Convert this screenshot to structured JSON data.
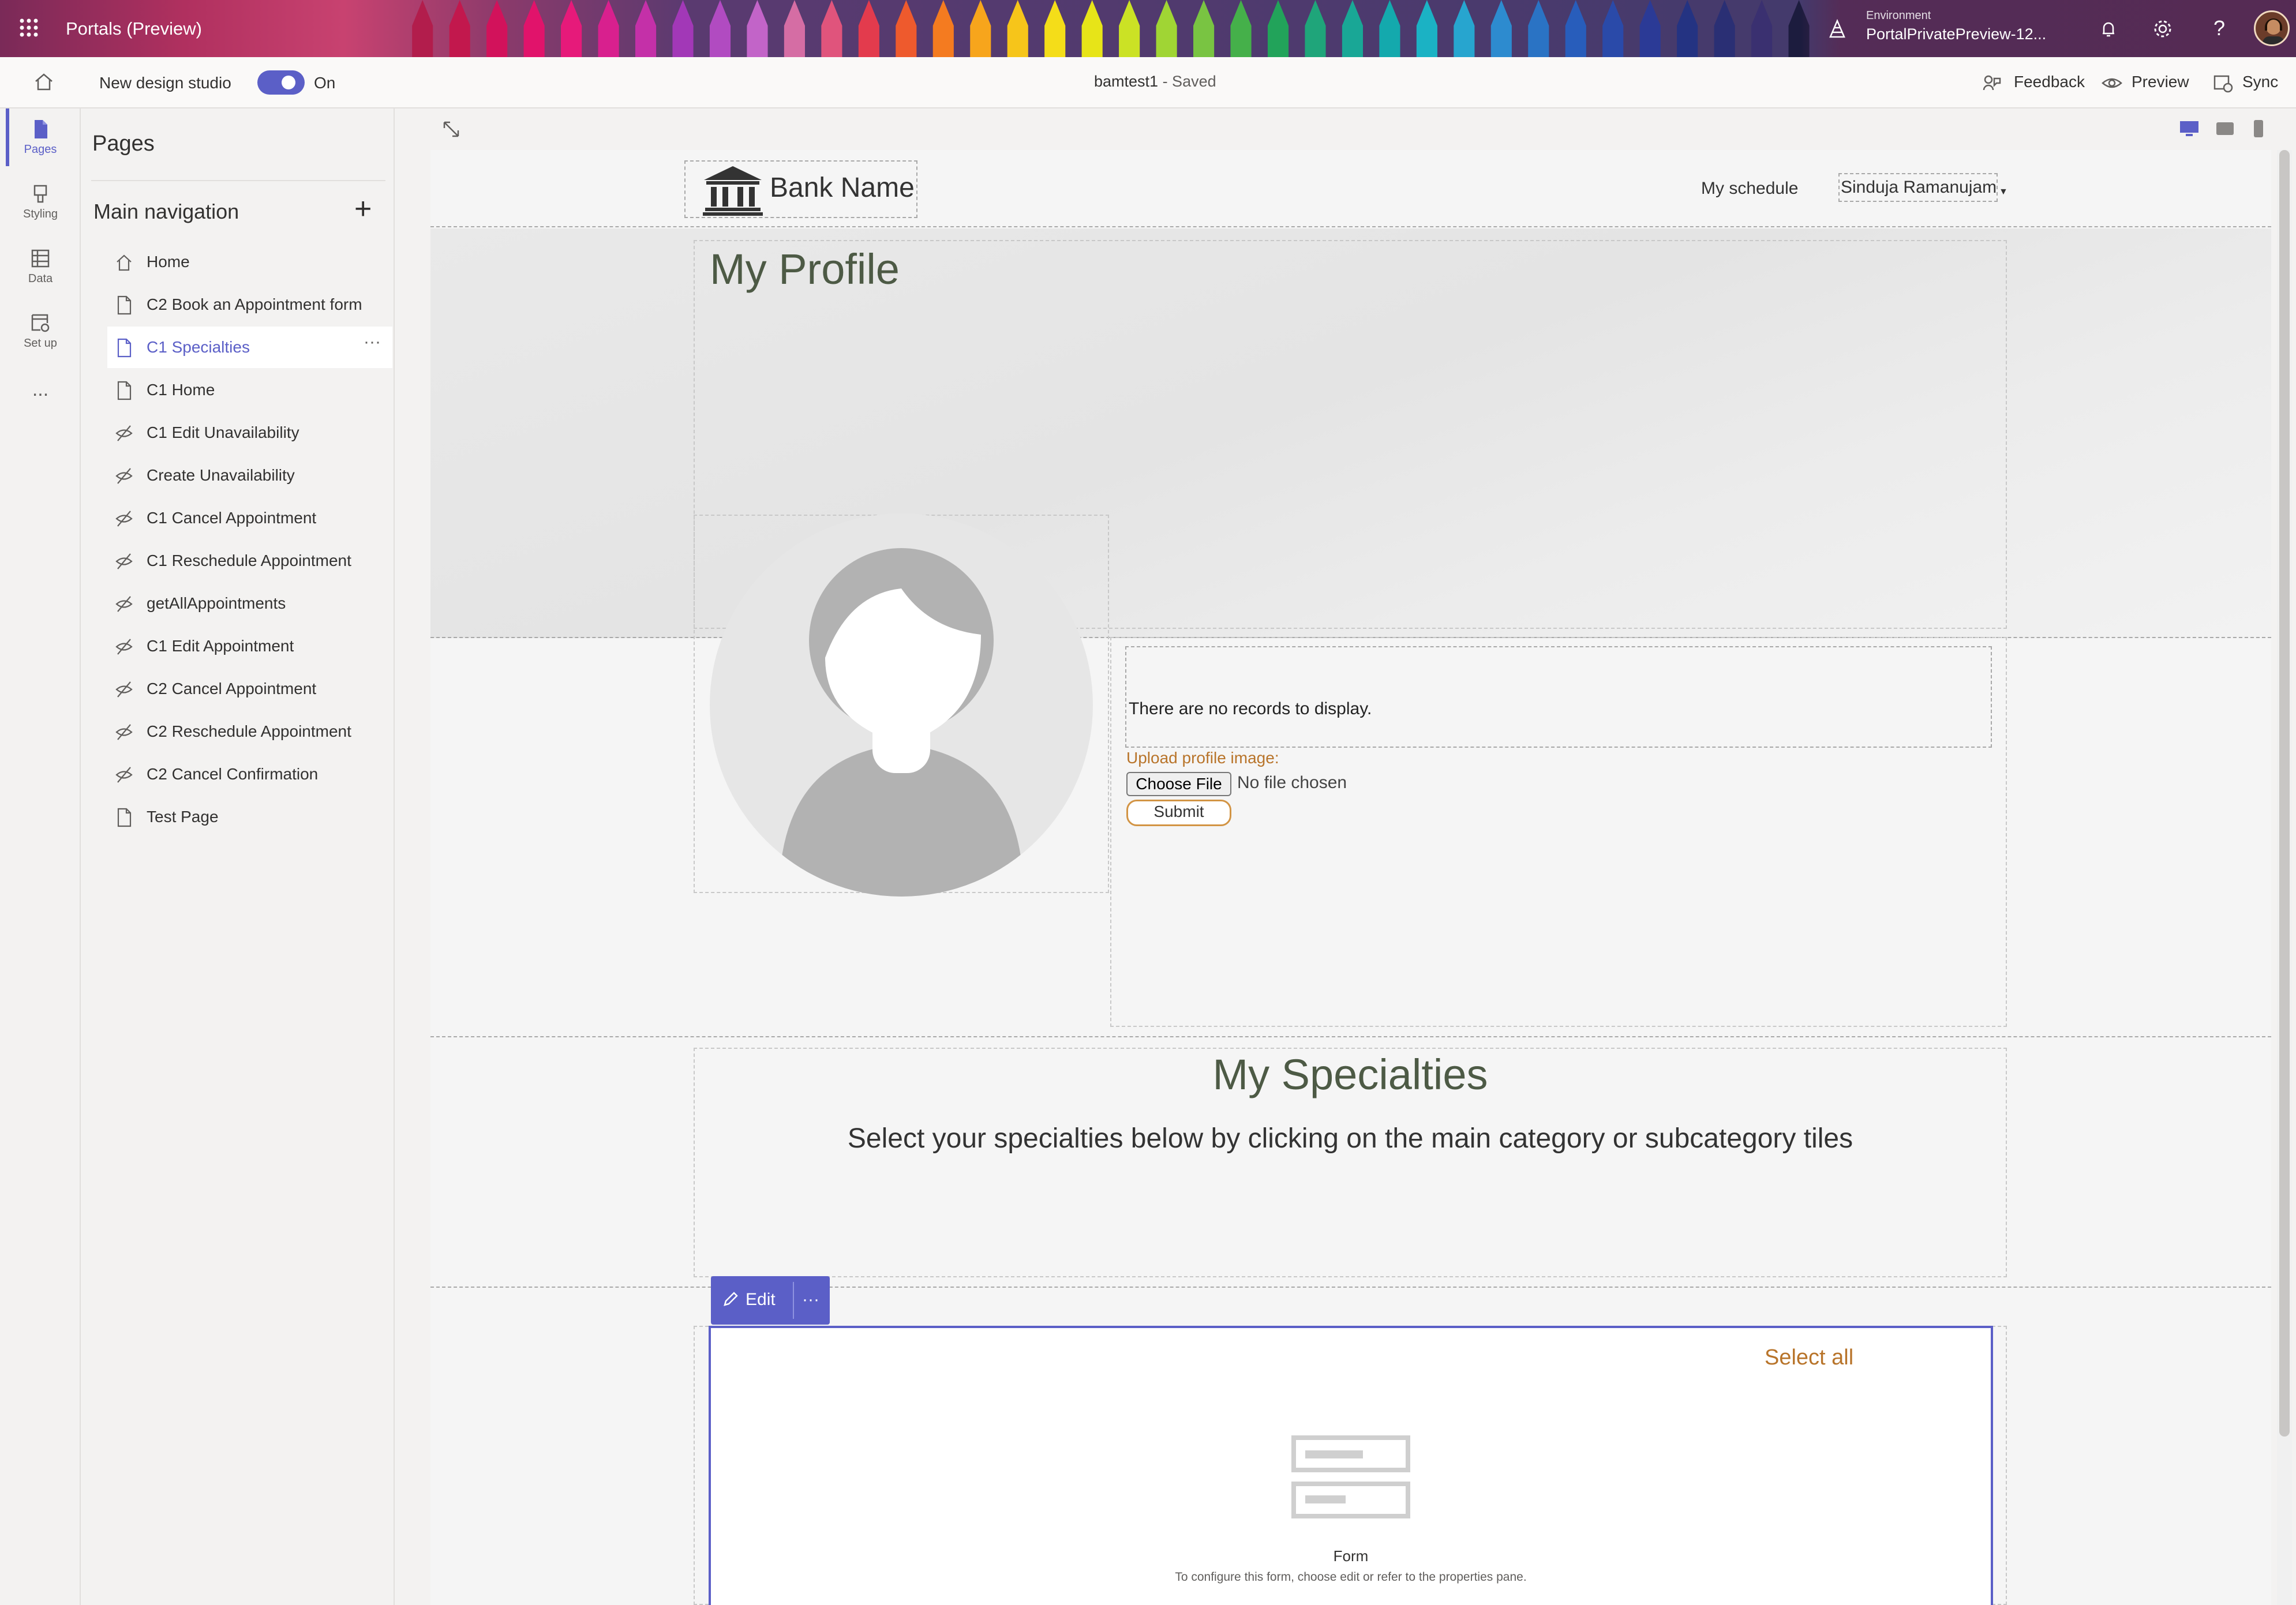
{
  "topbar": {
    "app_title": "Portals (Preview)",
    "env_label": "Environment",
    "env_value": "PortalPrivatePreview-12...",
    "crayon_colors": [
      "#b21d4c",
      "#c2184d",
      "#d2125b",
      "#e1136b",
      "#e61a7a",
      "#d8208e",
      "#c430a8",
      "#a238b7",
      "#b14bc1",
      "#c264c8",
      "#d56da4",
      "#e0547c",
      "#e33b4d",
      "#ee5a2d",
      "#f47b20",
      "#f7a51c",
      "#f6c51a",
      "#f4dd19",
      "#e7e418",
      "#cbe225",
      "#a0d534",
      "#79c442",
      "#45b04a",
      "#22a35a",
      "#1fa57a",
      "#19a796",
      "#14a9ad",
      "#1bb2c4",
      "#27a5cf",
      "#2d8bcf",
      "#2a73c4",
      "#285dbb",
      "#2a4aa9",
      "#2b3a96",
      "#243382",
      "#2a2f74",
      "#3a3070",
      "#1c1c3e"
    ]
  },
  "cmdbar": {
    "design_studio_label": "New design studio",
    "toggle_state": "On",
    "doc_name": "bamtest1",
    "doc_status": " - Saved",
    "feedback": "Feedback",
    "preview": "Preview",
    "sync": "Sync"
  },
  "rail": {
    "pages": "Pages",
    "styling": "Styling",
    "data": "Data",
    "setup": "Set up",
    "more": "..."
  },
  "panel": {
    "title": "Pages",
    "nav_title": "Main navigation",
    "add": "+",
    "item_more": "···",
    "items": [
      {
        "label": "Home"
      },
      {
        "label": "C2 Book an Appointment form"
      },
      {
        "label": "C1 Specialties"
      },
      {
        "label": "C1 Home"
      },
      {
        "label": "C1 Edit Unavailability"
      },
      {
        "label": "Create Unavailability"
      },
      {
        "label": "C1 Cancel Appointment"
      },
      {
        "label": "C1 Reschedule Appointment"
      },
      {
        "label": "getAllAppointments"
      },
      {
        "label": "C1 Edit Appointment"
      },
      {
        "label": "C2 Cancel Appointment"
      },
      {
        "label": "C2 Reschedule Appointment"
      },
      {
        "label": "C2 Cancel Confirmation"
      },
      {
        "label": "Test Page"
      }
    ]
  },
  "site": {
    "brand": "Bank Name",
    "nav_schedule": "My schedule",
    "user_name": "Sinduja Ramanujam",
    "profile_title": "My Profile",
    "no_records": "There are no records to display.",
    "upload_label": "Upload profile image:",
    "choose_file": "Choose File",
    "no_file": "No file chosen",
    "submit": "Submit",
    "specialties_title": "My Specialties",
    "specialties_sub": "Select your specialties below by clicking on the main category or subcategory tiles",
    "edit": "Edit",
    "edit_more": "···",
    "select_all": "Select all",
    "form_title": "Form",
    "form_hint": "To configure this form, choose edit or refer to the properties pane."
  },
  "colors": {
    "accent": "#5b5fc7",
    "site_orange": "#b8742a",
    "heading_green": "#4d5a45"
  }
}
